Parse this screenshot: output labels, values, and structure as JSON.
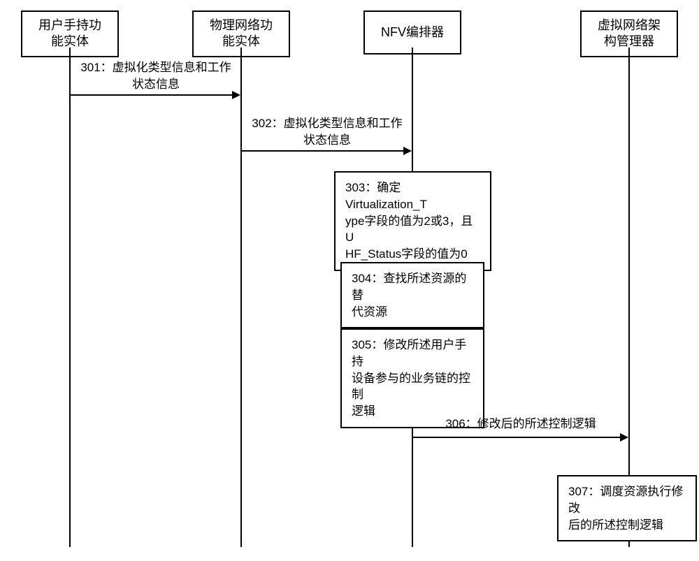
{
  "participants": {
    "p1": "用户手持功\n能实体",
    "p2": "物理网络功\n能实体",
    "p3": "NFV编排器",
    "p4": "虚拟网络架\n构管理器"
  },
  "messages": {
    "m301": "301：虚拟化类型信息和工作\n状态信息",
    "m302": "302：虚拟化类型信息和工作\n状态信息",
    "m306": "306：修改后的所述控制逻辑"
  },
  "processes": {
    "b303": "303：确定Virtualization_T\nype字段的值为2或3，且U\nHF_Status字段的值为0",
    "b304": "304：查找所述资源的替\n代资源",
    "b305": "305：修改所述用户手持\n设备参与的业务链的控制\n逻辑",
    "b307": "307：调度资源执行修改\n后的所述控制逻辑"
  }
}
